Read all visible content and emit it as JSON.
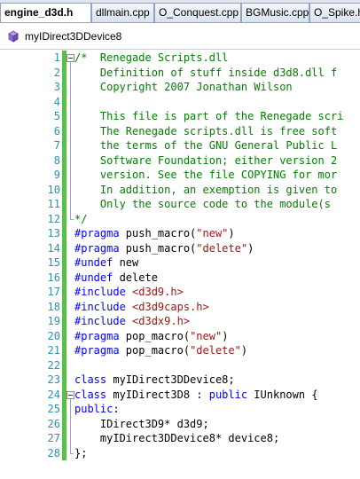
{
  "tabs": [
    {
      "label": "engine_d3d.h",
      "active": true
    },
    {
      "label": "dllmain.cpp",
      "active": false
    },
    {
      "label": "O_Conquest.cpp",
      "active": false
    },
    {
      "label": "BGMusic.cpp",
      "active": false
    },
    {
      "label": "O_Spike.h",
      "active": false
    }
  ],
  "class_dropdown": {
    "selected": "myIDirect3DDevice8",
    "icon": "class-icon"
  },
  "colors": {
    "comment": "#008000",
    "keyword": "#0000ff",
    "string": "#a31515",
    "plain": "#000000",
    "line_number": "#2b91af",
    "change_margin": "#57c04a"
  },
  "code_lines": [
    {
      "n": "1",
      "fold": "start",
      "tokens": [
        [
          "comment",
          "/*  Renegade Scripts.dll"
        ]
      ]
    },
    {
      "n": "2",
      "tokens": [
        [
          "comment",
          "    Definition of stuff inside d3d8.dll f"
        ]
      ]
    },
    {
      "n": "3",
      "tokens": [
        [
          "comment",
          "    Copyright 2007 Jonathan Wilson"
        ]
      ]
    },
    {
      "n": "4",
      "tokens": []
    },
    {
      "n": "5",
      "tokens": [
        [
          "comment",
          "    This file is part of the Renegade scri"
        ]
      ]
    },
    {
      "n": "6",
      "tokens": [
        [
          "comment",
          "    The Renegade scripts.dll is free soft"
        ]
      ]
    },
    {
      "n": "7",
      "tokens": [
        [
          "comment",
          "    the terms of the GNU General Public L"
        ]
      ]
    },
    {
      "n": "8",
      "tokens": [
        [
          "comment",
          "    Software Foundation; either version 2"
        ]
      ]
    },
    {
      "n": "9",
      "tokens": [
        [
          "comment",
          "    version. See the file COPYING for mor"
        ]
      ]
    },
    {
      "n": "10",
      "tokens": [
        [
          "comment",
          "    In addition, an exemption is given to"
        ]
      ]
    },
    {
      "n": "11",
      "tokens": [
        [
          "comment",
          "    Only the source code to the module(s"
        ]
      ]
    },
    {
      "n": "12",
      "fold": "end",
      "tokens": [
        [
          "comment",
          "*/"
        ]
      ]
    },
    {
      "n": "13",
      "tokens": [
        [
          "keyword",
          "#pragma"
        ],
        [
          "plain",
          " push_macro("
        ],
        [
          "string",
          "\"new\""
        ],
        [
          "plain",
          ")"
        ]
      ]
    },
    {
      "n": "14",
      "tokens": [
        [
          "keyword",
          "#pragma"
        ],
        [
          "plain",
          " push_macro("
        ],
        [
          "string",
          "\"delete\""
        ],
        [
          "plain",
          ")"
        ]
      ]
    },
    {
      "n": "15",
      "tokens": [
        [
          "keyword",
          "#undef"
        ],
        [
          "plain",
          " new"
        ]
      ]
    },
    {
      "n": "16",
      "tokens": [
        [
          "keyword",
          "#undef"
        ],
        [
          "plain",
          " delete"
        ]
      ]
    },
    {
      "n": "17",
      "tokens": [
        [
          "keyword",
          "#include"
        ],
        [
          "plain",
          " "
        ],
        [
          "string",
          "<d3d9.h>"
        ]
      ]
    },
    {
      "n": "18",
      "tokens": [
        [
          "keyword",
          "#include"
        ],
        [
          "plain",
          " "
        ],
        [
          "string",
          "<d3d9caps.h>"
        ]
      ]
    },
    {
      "n": "19",
      "tokens": [
        [
          "keyword",
          "#include"
        ],
        [
          "plain",
          " "
        ],
        [
          "string",
          "<d3dx9.h>"
        ]
      ]
    },
    {
      "n": "20",
      "tokens": [
        [
          "keyword",
          "#pragma"
        ],
        [
          "plain",
          " pop_macro("
        ],
        [
          "string",
          "\"new\""
        ],
        [
          "plain",
          ")"
        ]
      ]
    },
    {
      "n": "21",
      "tokens": [
        [
          "keyword",
          "#pragma"
        ],
        [
          "plain",
          " pop_macro("
        ],
        [
          "string",
          "\"delete\""
        ],
        [
          "plain",
          ")"
        ]
      ]
    },
    {
      "n": "22",
      "tokens": []
    },
    {
      "n": "23",
      "tokens": [
        [
          "keyword",
          "class"
        ],
        [
          "plain",
          " myIDirect3DDevice8;"
        ]
      ]
    },
    {
      "n": "24",
      "fold": "start",
      "tokens": [
        [
          "keyword",
          "class"
        ],
        [
          "plain",
          " myIDirect3D8 : "
        ],
        [
          "keyword",
          "public"
        ],
        [
          "plain",
          " IUnknown {"
        ]
      ]
    },
    {
      "n": "25",
      "tokens": [
        [
          "keyword",
          "public"
        ],
        [
          "plain",
          ":"
        ]
      ]
    },
    {
      "n": "26",
      "tokens": [
        [
          "plain",
          "    IDirect3D9* d3d9;"
        ]
      ]
    },
    {
      "n": "27",
      "tokens": [
        [
          "plain",
          "    myIDirect3DDevice8* device8;"
        ]
      ]
    },
    {
      "n": "28",
      "fold": "end",
      "tokens": [
        [
          "plain",
          "};"
        ]
      ]
    }
  ]
}
